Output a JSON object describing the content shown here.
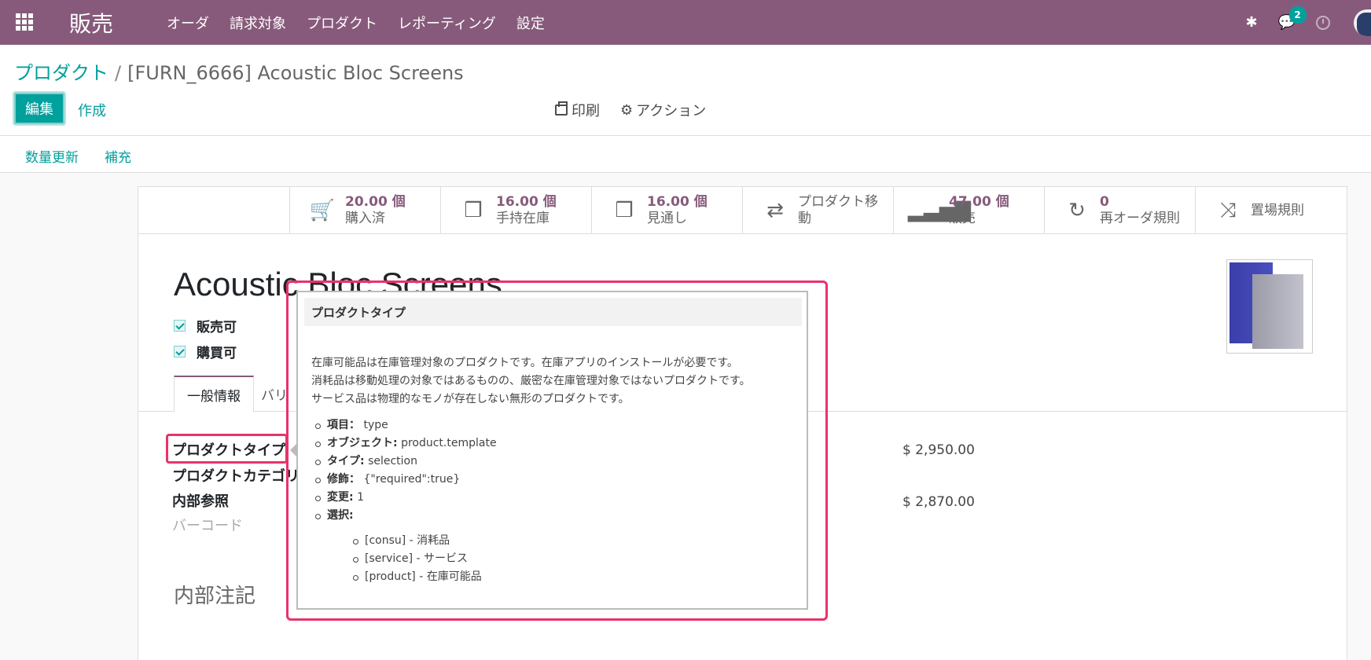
{
  "navbar": {
    "brand": "販売",
    "menu": [
      "オーダ",
      "請求対象",
      "プロダクト",
      "レポーティング",
      "設定"
    ],
    "chat_badge": "2",
    "color": "#875a7b"
  },
  "breadcrumb": {
    "parent": "プロダクト",
    "separator": "/",
    "current": "[FURN_6666] Acoustic Bloc Screens"
  },
  "control": {
    "edit": "編集",
    "create": "作成",
    "print": "印刷",
    "action": "アクション"
  },
  "status_bar": {
    "update_qty": "数量更新",
    "replenish": "補充"
  },
  "smart_buttons": [
    {
      "icon": "cart-icon",
      "value": "20.00 個",
      "label": "購入済"
    },
    {
      "icon": "cubes-icon",
      "value": "16.00 個",
      "label": "手持在庫"
    },
    {
      "icon": "cubes-icon",
      "value": "16.00 個",
      "label": "見通し"
    },
    {
      "icon": "exchange-icon",
      "value": "",
      "label": "プロダクト移動"
    },
    {
      "icon": "signal-icon",
      "value": "47.00 個",
      "label": "販売"
    },
    {
      "icon": "refresh-icon",
      "value": "0",
      "label": "再オーダ規則"
    },
    {
      "icon": "shuffle-icon",
      "value": "",
      "label": "置場規則"
    }
  ],
  "product": {
    "name": "Acoustic Bloc Screens",
    "can_sell": "販売可",
    "can_purchase": "購買可"
  },
  "tabs": [
    "一般情報",
    "バリ"
  ],
  "fields": {
    "type_label": "プロダクトタイプ",
    "category_label": "プロダクトカテゴリ",
    "ref_label": "内部参照",
    "barcode_label": "バーコード",
    "sales_price": "$ 2,950.00",
    "cost": "$ 2,870.00",
    "notes_title": "内部注記"
  },
  "tooltip": {
    "title": "プロダクトタイプ",
    "desc": [
      "在庫可能品は在庫管理対象のプロダクトです。在庫アプリのインストールが必要です。",
      "消耗品は移動処理の対象ではあるものの、厳密な在庫管理対象ではないプロダクトです。",
      "サービス品は物理的なモノが存在しない無形のプロダクトです。"
    ],
    "items": [
      {
        "key": "項目：",
        "value": "type"
      },
      {
        "key": "オブジェクト:",
        "value": "product.template"
      },
      {
        "key": "タイプ:",
        "value": "selection"
      },
      {
        "key": "修飾：",
        "value": "{\"required\":true}"
      },
      {
        "key": "変更:",
        "value": "1"
      },
      {
        "key": "選択:",
        "value": ""
      }
    ],
    "selection": [
      "[consu] - 消耗品",
      "[service] - サービス",
      "[product] - 在庫可能品"
    ]
  },
  "colors": {
    "accent": "#00a09d",
    "highlight": "#e8336a"
  }
}
